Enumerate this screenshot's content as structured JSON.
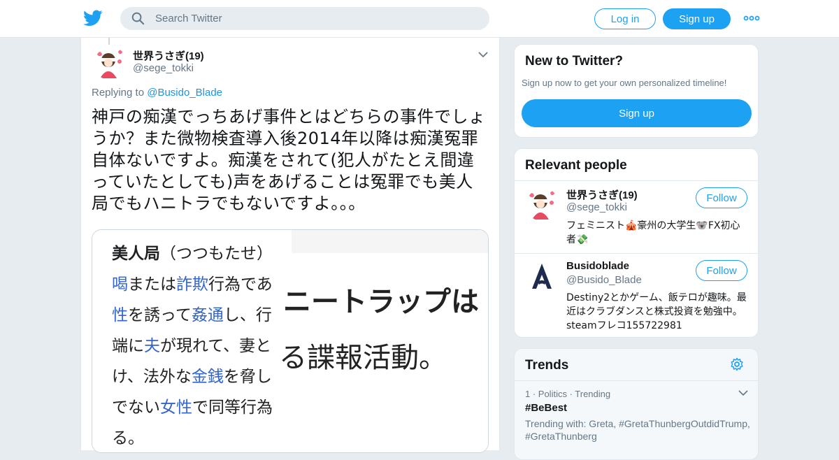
{
  "header": {
    "search_placeholder": "Search Twitter",
    "login_label": "Log in",
    "signup_label": "Sign up",
    "brand_color": "#1da1f2"
  },
  "tweet": {
    "display_name": "世界うさぎ(19)",
    "handle": "@sege_tokki",
    "replying_prefix": "Replying to",
    "replying_to": "@Busido_Blade",
    "text": "神戸の痴漢でっちあげ事件とはどちらの事件でしょうか？また微物検査導入後2014年以降は痴漢冤罪自体ないですよ。痴漢をされて(犯人がたとえ間違っていたとしても)声をあげることは冤罪でも美人局でもハニトラでもないですよ。。。"
  },
  "media": {
    "left": {
      "title_main": "美人局",
      "title_reading": "（つつもたせ）",
      "lines": [
        [
          {
            "t": "喝",
            "link": true
          },
          {
            "t": "または",
            "link": false
          },
          {
            "t": "詐欺",
            "link": true
          },
          {
            "t": "行為であ",
            "link": false
          }
        ],
        [
          {
            "t": "性",
            "link": true
          },
          {
            "t": "を誘って",
            "link": false
          },
          {
            "t": "姦通",
            "link": true
          },
          {
            "t": "し、行",
            "link": false
          }
        ],
        [
          {
            "t": "端に",
            "link": false
          },
          {
            "t": "夫",
            "link": true
          },
          {
            "t": "が現れて、妻と",
            "link": false
          }
        ],
        [
          {
            "t": "け、法外な",
            "link": false
          },
          {
            "t": "金銭",
            "link": true
          },
          {
            "t": "を脅し",
            "link": false
          }
        ],
        [
          {
            "t": "でない",
            "link": false
          },
          {
            "t": "女性",
            "link": true
          },
          {
            "t": "で同等行為",
            "link": false
          }
        ],
        [
          {
            "t": "る。",
            "link": false
          }
        ]
      ]
    },
    "right": {
      "line1": "ニートラップは",
      "line2": "る諜報活動。"
    }
  },
  "sidebar": {
    "new_card": {
      "title": "New to Twitter?",
      "subtitle": "Sign up now to get your own personalized timeline!",
      "button": "Sign up"
    },
    "people_card": {
      "title": "Relevant people",
      "people": [
        {
          "name": "世界うさぎ(19)",
          "handle": "@sege_tokki",
          "bio": "フェミニスト🎪豪州の大学生🐨FX初心者💸",
          "follow": "Follow"
        },
        {
          "name": "Busidoblade",
          "handle": "@Busido_Blade",
          "bio": "Destiny2とかゲーム、飯テロが趣味。最近はクラブダンスと株式投資を勉強中。steamフレコ155722981",
          "follow": "Follow"
        }
      ]
    },
    "trends_card": {
      "title": "Trends",
      "items": [
        {
          "meta": "1 · Politics · Trending",
          "title": "#BeBest",
          "with": "Trending with: Greta, #GretaThunbergOutdidTrump, #GretaThunberg"
        }
      ]
    }
  }
}
